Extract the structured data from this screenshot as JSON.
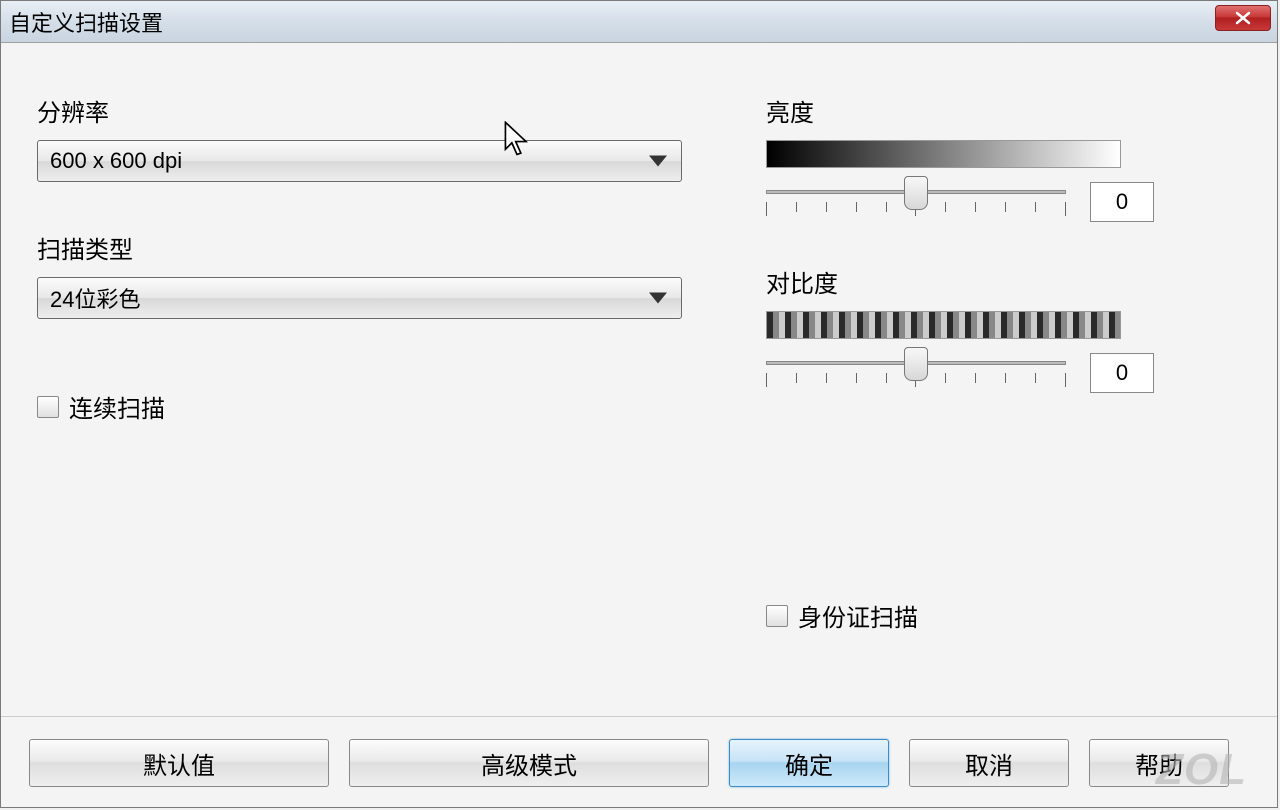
{
  "window": {
    "title": "自定义扫描设置"
  },
  "left": {
    "resolution_label": "分辨率",
    "resolution_value": "600 x 600 dpi",
    "scan_type_label": "扫描类型",
    "scan_type_value": "24位彩色",
    "continuous_scan_label": "连续扫描"
  },
  "right": {
    "brightness_label": "亮度",
    "brightness_value": "0",
    "contrast_label": "对比度",
    "contrast_value": "0",
    "id_scan_label": "身份证扫描"
  },
  "buttons": {
    "default": "默认值",
    "advanced": "高级模式",
    "ok": "确定",
    "cancel": "取消",
    "help": "帮助"
  },
  "watermark": "ZOL"
}
